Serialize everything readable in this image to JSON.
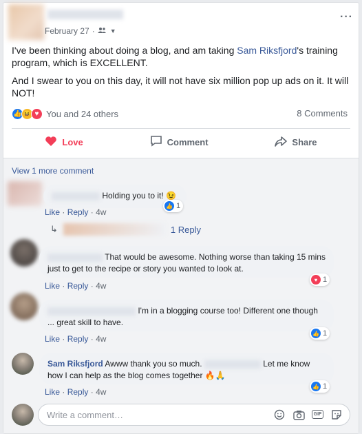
{
  "post": {
    "date": "February 27",
    "audience_icon": "friends-icon",
    "text_1_before": "I've been thinking about doing a blog, and am taking ",
    "text_1_link": "Sam Riksfjord",
    "text_1_after": "'s training program, which is EXCELLENT.",
    "text_2": "And I swear to you on this day, it will not have six million pop up ads on it. It will NOT!",
    "reaction_summary": "You and 24 others",
    "comment_count": "8 Comments"
  },
  "actions": {
    "love": "Love",
    "comment": "Comment",
    "share": "Share"
  },
  "comments_section": {
    "view_more": "View 1 more comment",
    "comments": [
      {
        "text": "Holding you to it! 😉",
        "like": "Like",
        "reply": "Reply",
        "age": "4w",
        "reaction_count": "1",
        "reaction": "like"
      },
      {
        "text": "That would be awesome. Nothing worse than taking 15 mins just to get to the recipe or story you wanted to look at.",
        "like": "Like",
        "reply": "Reply",
        "age": "4w",
        "reaction_count": "1",
        "reaction": "love"
      },
      {
        "text": "I'm in a blogging course too! Different one though ... great skill to have.",
        "like": "Like",
        "reply": "Reply",
        "age": "4w",
        "reaction_count": "1",
        "reaction": "like"
      },
      {
        "author": "Sam Riksfjord",
        "text_before": "Awww thank you so much.",
        "text_after": "Let me know how I can help as the blog comes together 🔥🙏",
        "like": "Like",
        "reply": "Reply",
        "age": "4w",
        "reaction_count": "1",
        "reaction": "like"
      }
    ],
    "replies_link": "1 Reply",
    "separator": "·"
  },
  "composer": {
    "placeholder": "Write a comment…"
  }
}
